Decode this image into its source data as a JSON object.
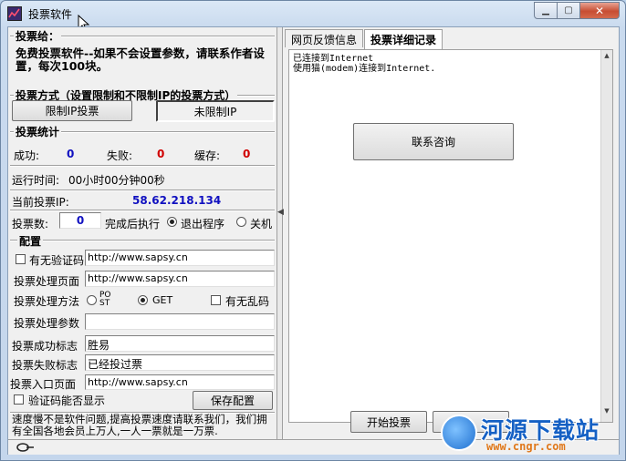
{
  "window": {
    "title": "投票软件"
  },
  "vote_to": {
    "title": "投票给：",
    "notice": "免费投票软件--如果不会设置参数，请联系作者设置，每次100块。"
  },
  "mode": {
    "title": "投票方式（设置限制和不限制IP的投票方式）",
    "limited_ip_button": "限制IP投票",
    "unlimited_ip_button": "未限制IP"
  },
  "stats": {
    "title": "投票统计",
    "success_label": "成功:",
    "success_value": "0",
    "fail_label": "失败:",
    "fail_value": "0",
    "cache_label": "缓存:",
    "cache_value": "0",
    "runtime_label": "运行时间:",
    "runtime_value": "00小时00分钟00秒",
    "ip_label": "当前投票IP:",
    "ip_value": "58.62.218.134",
    "count_label": "投票数:",
    "count_value": "0",
    "after_label": "完成后执行",
    "exit_option": "退出程序",
    "shutdown_option": "关机"
  },
  "config": {
    "title": "配置",
    "captcha_label": "有无验证码",
    "captcha_value": "http://www.sapsy.cn",
    "page_label": "投票处理页面",
    "page_value": "http://www.sapsy.cn",
    "method_label": "投票处理方法",
    "post_option": "POST",
    "get_option": "GET",
    "garble_label": "有无乱码",
    "params_label": "投票处理参数",
    "params_value": "",
    "success_flag_label": "投票成功标志",
    "success_flag_value": "胜易",
    "fail_flag_label": "投票失败标志",
    "fail_flag_value": "已经投过票",
    "entry_label": "投票入口页面",
    "entry_value": "http://www.sapsy.cn",
    "captcha_show_label": "验证码能否显示",
    "save_button": "保存配置"
  },
  "footer_notice": "速度慢不是软件问题,提高投票速度请联系我们，我们拥有全国各地会员上万人,一人一票就是一万票.",
  "tabs": [
    {
      "label": "网页反馈信息"
    },
    {
      "label": "投票详细记录"
    }
  ],
  "log_text": "已连接到Internet\n使用猫(modem)连接到Internet.",
  "contact_button": "联系咨询",
  "start_button": "开始投票",
  "watermark": {
    "title": "河源下载站",
    "url": "www.cngr.com"
  }
}
